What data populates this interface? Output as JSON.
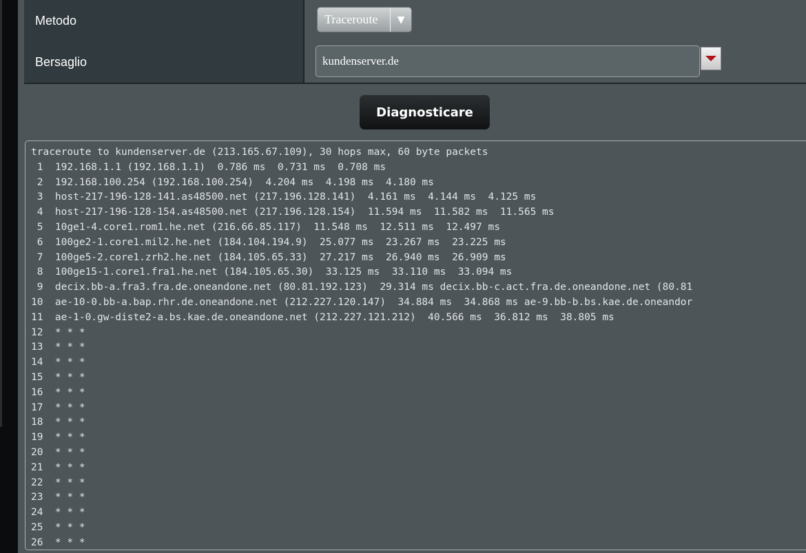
{
  "form": {
    "method_label": "Metodo",
    "method_value": "Traceroute",
    "target_label": "Bersaglio",
    "target_value": "kundenserver.de"
  },
  "actions": {
    "diagnose_label": "Diagnosticare"
  },
  "output": {
    "lines": [
      "traceroute to kundenserver.de (213.165.67.109), 30 hops max, 60 byte packets",
      " 1  192.168.1.1 (192.168.1.1)  0.786 ms  0.731 ms  0.708 ms",
      " 2  192.168.100.254 (192.168.100.254)  4.204 ms  4.198 ms  4.180 ms",
      " 3  host-217-196-128-141.as48500.net (217.196.128.141)  4.161 ms  4.144 ms  4.125 ms",
      " 4  host-217-196-128-154.as48500.net (217.196.128.154)  11.594 ms  11.582 ms  11.565 ms",
      " 5  10ge1-4.core1.rom1.he.net (216.66.85.117)  11.548 ms  12.511 ms  12.497 ms",
      " 6  100ge2-1.core1.mil2.he.net (184.104.194.9)  25.077 ms  23.267 ms  23.225 ms",
      " 7  100ge5-2.core1.zrh2.he.net (184.105.65.33)  27.217 ms  26.940 ms  26.909 ms",
      " 8  100ge15-1.core1.fra1.he.net (184.105.65.30)  33.125 ms  33.110 ms  33.094 ms",
      " 9  decix.bb-a.fra3.fra.de.oneandone.net (80.81.192.123)  29.314 ms decix.bb-c.act.fra.de.oneandone.net (80.81",
      "10  ae-10-0.bb-a.bap.rhr.de.oneandone.net (212.227.120.147)  34.884 ms  34.868 ms ae-9.bb-b.bs.kae.de.oneandor",
      "11  ae-1-0.gw-diste2-a.bs.kae.de.oneandone.net (212.227.121.212)  40.566 ms  36.812 ms  38.805 ms",
      "12  * * *",
      "13  * * *",
      "14  * * *",
      "15  * * *",
      "16  * * *",
      "17  * * *",
      "18  * * *",
      "19  * * *",
      "20  * * *",
      "21  * * *",
      "22  * * *",
      "23  * * *",
      "24  * * *",
      "25  * * *",
      "26  * * *"
    ]
  },
  "icons": {
    "method_dropdown": "triangle-down-icon",
    "target_dropdown": "red-triangle-down-icon"
  },
  "colors": {
    "background": "#4d5559",
    "label_cell": "#313a3e",
    "button_dark": "#101213",
    "dropdown_arrow_red": "#b0151b"
  }
}
